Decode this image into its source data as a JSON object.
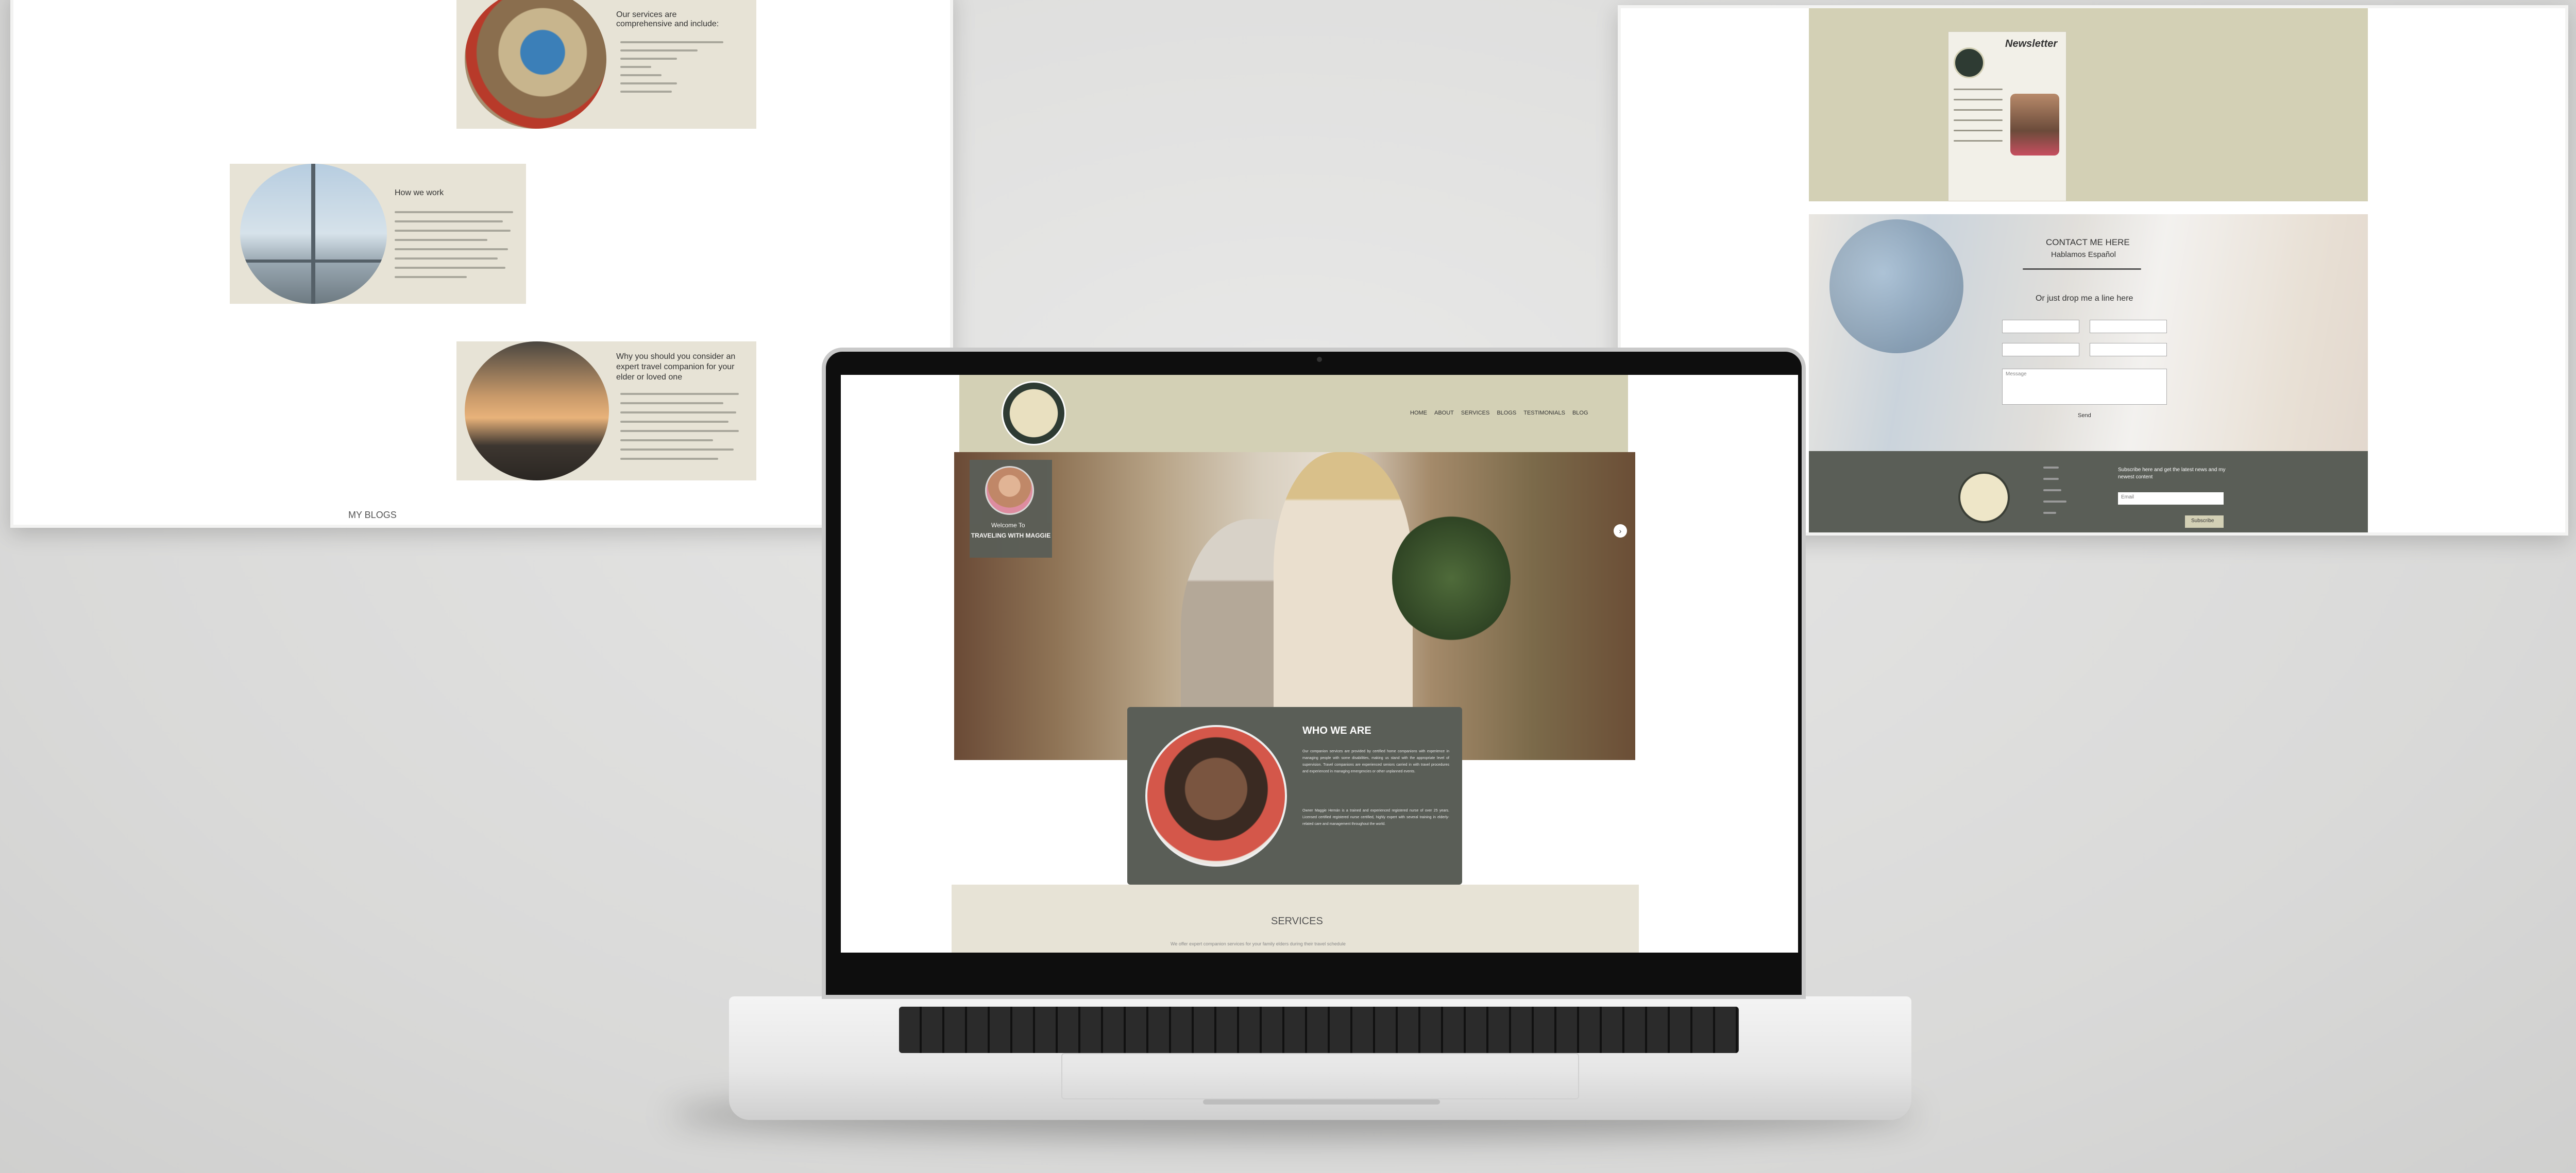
{
  "left_panel": {
    "services_heading": "Our services are comprehensive and include:",
    "how_heading": "How we work",
    "why_heading": "Why you should you consider an expert travel companion for your elder or loved one",
    "blogs_label": "MY BLOGS"
  },
  "right_panel": {
    "newsletter_title": "Newsletter",
    "contact_heading": "CONTACT ME HERE",
    "contact_sub": "Hablamos Español",
    "drop_line": "Or just drop me a line here",
    "message_placeholder": "Message",
    "send_label": "Send",
    "subscribe_text": "Subscribe here and get the latest news and my newest content",
    "email_placeholder": "Email",
    "subscribe_label": "Subscribe"
  },
  "laptop": {
    "nav": [
      "HOME",
      "ABOUT",
      "SERVICES",
      "BLOGS",
      "TESTIMONIALS",
      "BLOG"
    ],
    "hero_welcome": "Welcome To",
    "hero_brand": "TRAVELING WITH MAGGIE",
    "who_title": "WHO WE ARE",
    "who_p1": "Our companion services are provided by certified home companions with experience in managing people with some disabilities, making us stand with the appropriate level of supervision. Travel companions are experienced seniors carried in with travel procedures and experienced in managing emergencies or other unplanned events.",
    "who_p2": "Owner Maggie Hernán is a trained and experienced registered nurse of over 25 years. Licensed certified registered nurse certified, highly expert with several training in elderly-related care and management throughout the world.",
    "services_title": "SERVICES",
    "services_sub": "We offer expert companion services for your family elders during their travel schedule"
  },
  "colors": {
    "cream": "#e7e3d6",
    "olive": "#d3d0b5",
    "dark": "#5a5e57",
    "accent": "#c7bd8e"
  }
}
